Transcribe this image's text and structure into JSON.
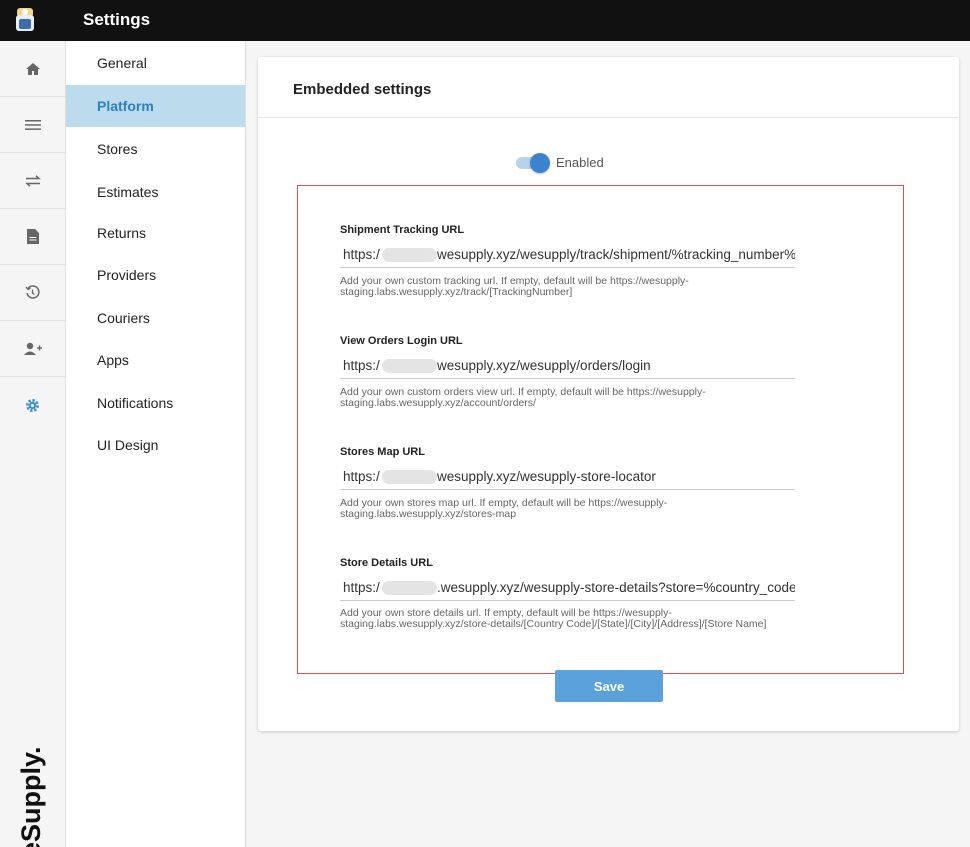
{
  "header": {
    "title": "Settings"
  },
  "iconbar": {
    "items": [
      {
        "icon": "home-icon",
        "glyph": "🏠"
      },
      {
        "icon": "list-icon",
        "glyph": "☰"
      },
      {
        "icon": "transfer-icon",
        "glyph": "⇄"
      },
      {
        "icon": "document-icon",
        "glyph": "📄"
      },
      {
        "icon": "history-icon",
        "glyph": "↺"
      },
      {
        "icon": "add-user-icon",
        "glyph": "👤"
      },
      {
        "icon": "gear-icon",
        "glyph": "⚙"
      }
    ],
    "active": "gear-icon"
  },
  "brand": {
    "logo_text": "WeSupply."
  },
  "submenu": {
    "items": [
      {
        "label": "General"
      },
      {
        "label": "Platform"
      },
      {
        "label": "Stores"
      },
      {
        "label": "Estimates"
      },
      {
        "label": "Returns"
      },
      {
        "label": "Providers"
      },
      {
        "label": "Couriers"
      },
      {
        "label": "Apps"
      },
      {
        "label": "Notifications"
      },
      {
        "label": "UI Design"
      }
    ],
    "active": "Platform"
  },
  "card": {
    "title": "Embedded settings",
    "toggle": {
      "label": "Enabled",
      "on": true
    },
    "fields": [
      {
        "label": "Shipment Tracking URL",
        "value_prefix": "https:/",
        "value_rest": "wesupply.xyz/wesupply/track/shipment/%tracking_number%",
        "help": "Add your own custom tracking url. If empty, default will be https://wesupply-staging.labs.wesupply.xyz/track/[TrackingNumber]"
      },
      {
        "label": "View Orders Login URL",
        "value_prefix": "https:/",
        "value_rest": "wesupply.xyz/wesupply/orders/login",
        "help": "Add your own custom orders view url. If empty, default will be https://wesupply-staging.labs.wesupply.xyz/account/orders/"
      },
      {
        "label": "Stores Map URL",
        "value_prefix": "https:/",
        "value_rest": "wesupply.xyz/wesupply-store-locator",
        "help": "Add your own stores map url. If empty, default will be https://wesupply-staging.labs.wesupply.xyz/stores-map"
      },
      {
        "label": "Store Details URL",
        "value_prefix": "https:/",
        "value_rest": ".wesupply.xyz/wesupply-store-details?store=%country_code%/",
        "help": "Add your own store details url. If empty, default will be https://wesupply-staging.labs.wesupply.xyz/store-details/[Country Code]/[State]/[City]/[Address]/[Store Name]"
      }
    ],
    "save_label": "Save"
  },
  "colors": {
    "topbar": "#111111",
    "accent": "#3b8ed6",
    "active_menu_bg": "#bcdced",
    "highlight_border": "#d9534f",
    "save_button": "#5ba2dc"
  }
}
